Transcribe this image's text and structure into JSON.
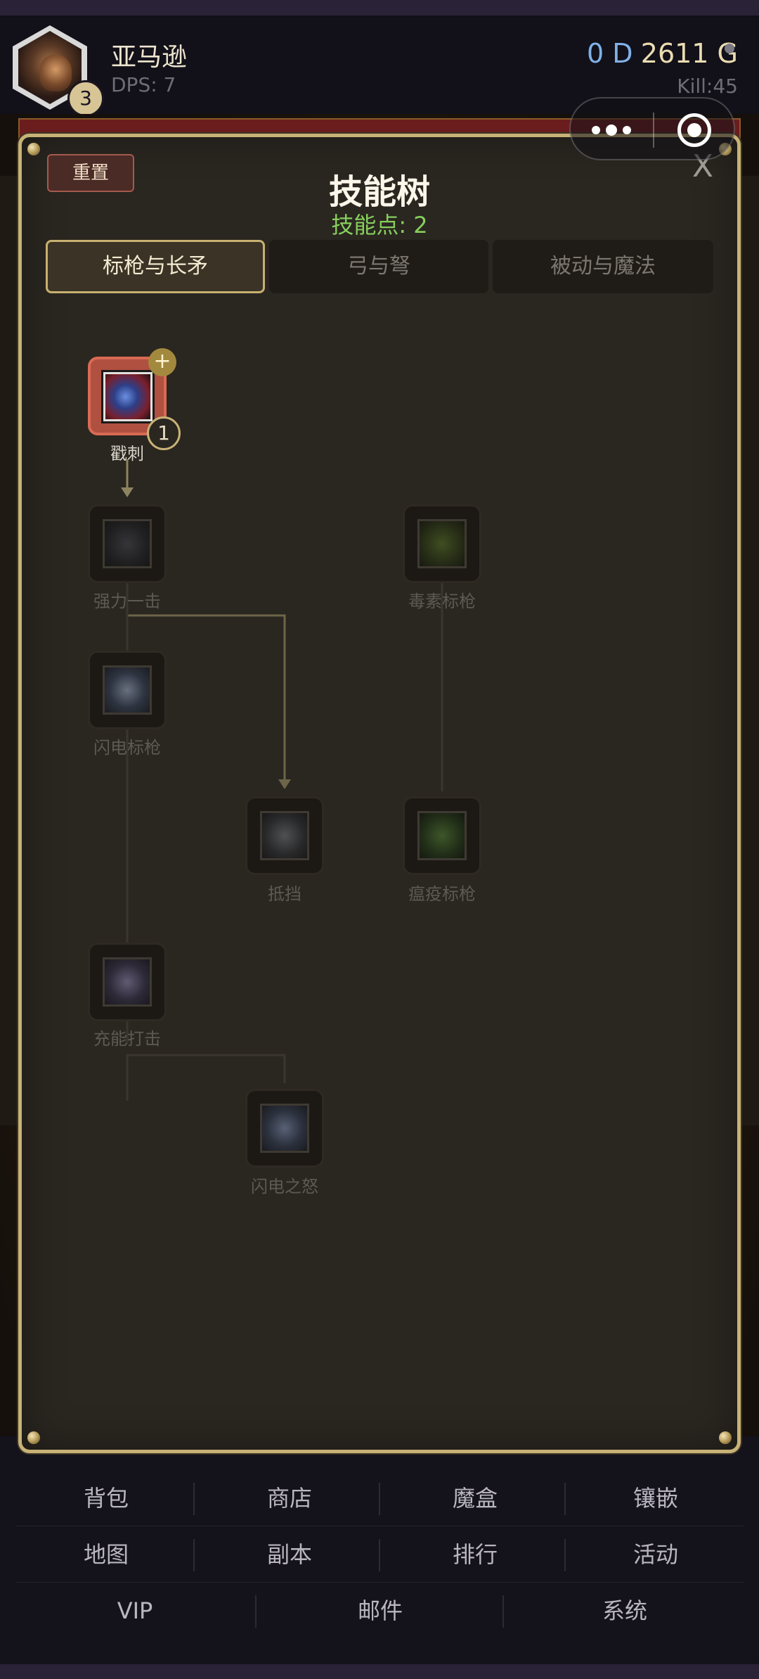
{
  "header": {
    "player_name": "亚马逊",
    "level": "3",
    "dps": "DPS: 7",
    "currency_d": "0 D",
    "currency_g": "2611 G",
    "kill": "Kill:45"
  },
  "modal": {
    "reset_label": "重置",
    "title": "技能树",
    "skill_points": "技能点: 2",
    "close_label": "X",
    "tabs": [
      {
        "label": "标枪与长矛",
        "active": true
      },
      {
        "label": "弓与弩",
        "active": false
      },
      {
        "label": "被动与魔法",
        "active": false
      }
    ],
    "skills": [
      {
        "name": "戳刺",
        "rank": "1",
        "unlocked": true,
        "icon": "stab-icon"
      },
      {
        "name": "强力一击",
        "unlocked": false,
        "icon": "power-strike-icon"
      },
      {
        "name": "毒素标枪",
        "unlocked": false,
        "icon": "poison-javelin-icon"
      },
      {
        "name": "闪电标枪",
        "unlocked": false,
        "icon": "lightning-javelin-icon"
      },
      {
        "name": "抵挡",
        "unlocked": false,
        "icon": "parry-icon"
      },
      {
        "name": "瘟疫标枪",
        "unlocked": false,
        "icon": "plague-javelin-icon"
      },
      {
        "name": "充能打击",
        "unlocked": false,
        "icon": "charged-strike-icon"
      },
      {
        "name": "闪电之怒",
        "unlocked": false,
        "icon": "lightning-fury-icon"
      }
    ],
    "plus_label": "+"
  },
  "menu": {
    "row1": [
      "背包",
      "商店",
      "魔盒",
      "镶嵌"
    ],
    "row2": [
      "地图",
      "副本",
      "排行",
      "活动"
    ],
    "row3": [
      "VIP",
      "邮件",
      "系统"
    ]
  },
  "colors": {
    "accent_gold": "#c8b276",
    "skill_points_green": "#86cf5c",
    "currency_d_blue": "#7fb1e8",
    "unlocked_red": "#b05040"
  }
}
